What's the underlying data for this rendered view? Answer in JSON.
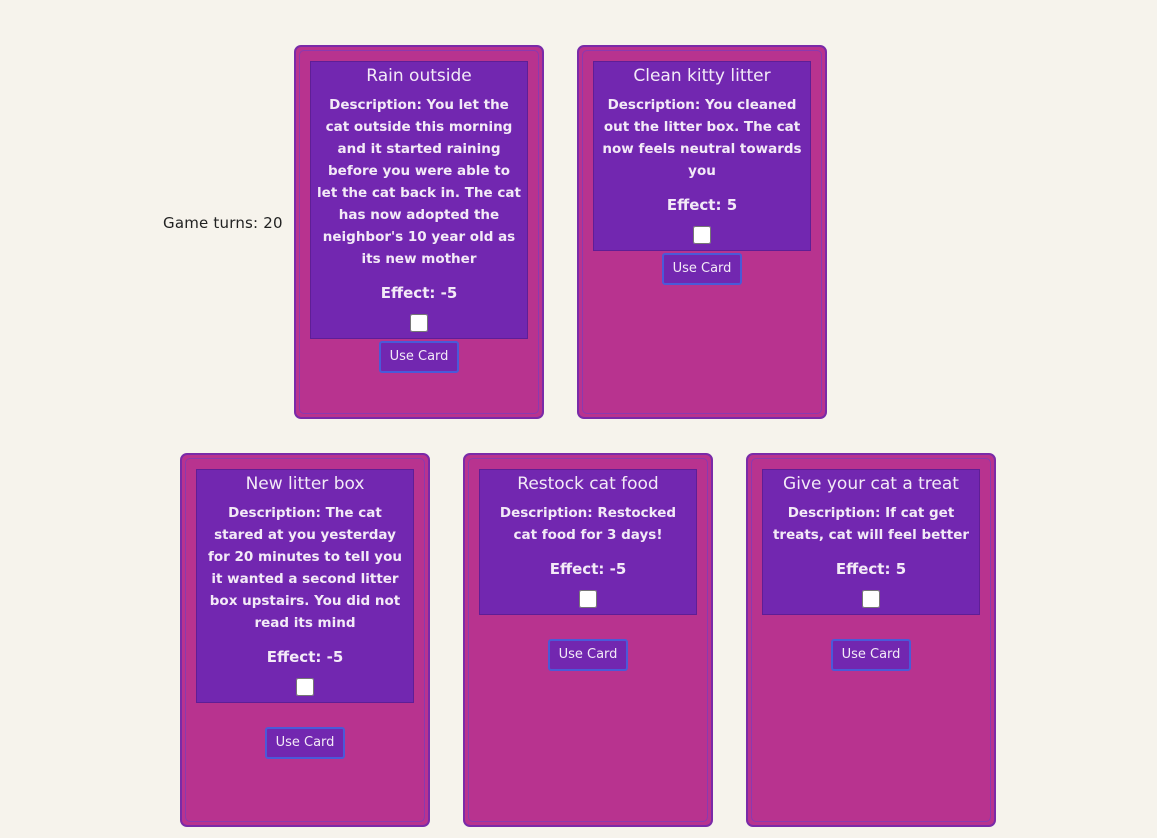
{
  "game": {
    "turns_label": "Game turns: 20"
  },
  "cards": [
    {
      "title": "Rain outside",
      "description": "Description: You let the cat outside this morning and it started raining before you were able to let the cat back in. The cat has now adopted the neighbor's 10 year old as its new mother",
      "effect": "Effect: -5",
      "checked": false,
      "button_label": "Use Card"
    },
    {
      "title": "Clean kitty litter",
      "description": "Description: You cleaned out the litter box. The cat now feels neutral towards you",
      "effect": "Effect: 5",
      "checked": false,
      "button_label": "Use Card"
    },
    {
      "title": "New litter box",
      "description": "Description: The cat stared at you yesterday for 20 minutes to tell you it wanted a second litter box upstairs. You did not read its mind",
      "effect": "Effect: -5",
      "checked": false,
      "button_label": "Use Card"
    },
    {
      "title": "Restock cat food",
      "description": "Description: Restocked cat food for 3 days!",
      "effect": "Effect: -5",
      "checked": false,
      "button_label": "Use Card"
    },
    {
      "title": "Give your cat a treat",
      "description": "Description: If cat get treats, cat will feel better",
      "effect": "Effect: 5",
      "checked": false,
      "button_label": "Use Card"
    }
  ]
}
